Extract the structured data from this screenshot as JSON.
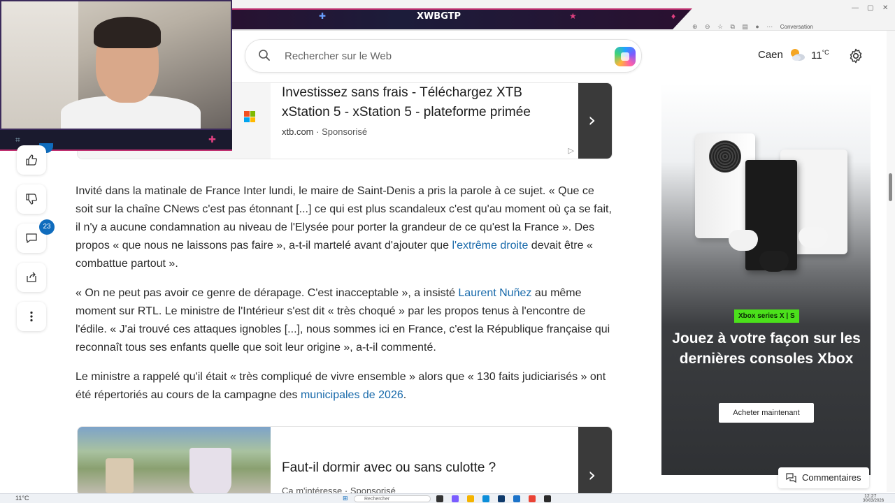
{
  "stream": {
    "banner_title": "XWBGTP"
  },
  "browser": {
    "conversation_label": "Conversation"
  },
  "header": {
    "search_placeholder": "Rechercher sur le Web",
    "weather_city": "Caen",
    "weather_temp": "11",
    "weather_unit": "°C"
  },
  "ad_top": {
    "title": "Investissez sans frais - Téléchargez XTB xStation 5 - xStation 5 - plateforme primée",
    "domain": "xtb.com",
    "sponsor": "Sponsorisé"
  },
  "rail": {
    "comment_count": "23"
  },
  "article": {
    "p1_text": "Invité dans la matinale de France Inter lundi, le maire de Saint-Denis a pris la parole à ce sujet. « Que ce soit sur la chaîne CNews c'est pas étonnant [...] ce qui est plus scandaleux c'est qu'au moment où ça se fait, il n'y a aucune condamnation au niveau de l'Elysée pour porter la grandeur de ce qu'est la France ». Des propos « que nous ne laissons pas faire », a-t-il martelé avant d'ajouter que ",
    "p1_link": "l'extrême droite",
    "p1_end": " devait être « combattue partout ».",
    "p2_start": "« On ne peut pas avoir ce genre de dérapage. C'est inacceptable », a insisté ",
    "p2_link": "Laurent Nuñez",
    "p2_end": " au même moment sur RTL. Le ministre de l'Intérieur s'est dit « très choqué » par les propos tenus à l'encontre de l'édile. « J'ai trouvé ces attaques ignobles [...], nous sommes ici en France, c'est la République française qui reconnaît tous ses enfants quelle que soit leur origine », a-t-il commenté.",
    "p3_start": "Le ministre a rappelé qu'il était « très compliqué de vivre ensemble » alors que « 130 faits judiciarisés » ont été répertoriés au cours de la campagne des ",
    "p3_link": "municipales de 2026",
    "p3_end": "."
  },
  "ad_bottom": {
    "title": "Faut-il dormir avec ou sans culotte ?",
    "source": "Ca m'intéresse · Sponsorisé"
  },
  "xbox_ad": {
    "tag": "Xbox series X | S",
    "headline": "Jouez à votre façon sur les dernières consoles Xbox",
    "cta": "Acheter maintenant"
  },
  "comments_button": "Commentaires",
  "taskbar": {
    "search": "Rechercher",
    "weather": "11°C",
    "time": "12:27",
    "date": "30/03/2026"
  },
  "colors": {
    "link": "#1769aa",
    "badge": "#0f6cbd",
    "xbox_green": "#4be01b"
  }
}
